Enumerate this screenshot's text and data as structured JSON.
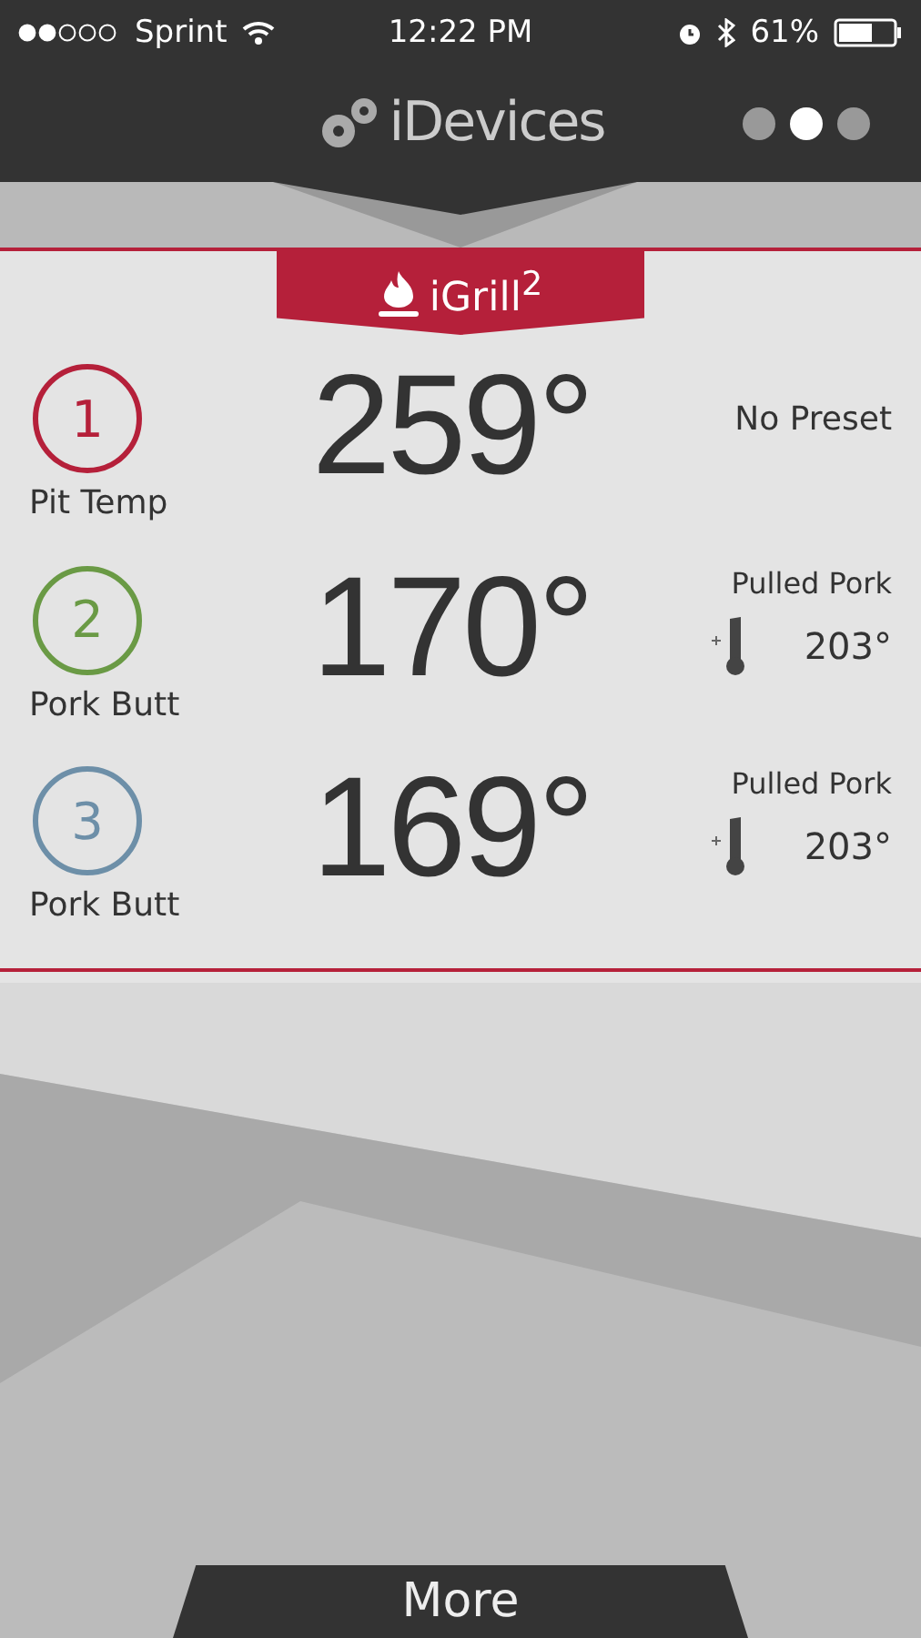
{
  "status_bar": {
    "carrier": "Sprint",
    "time": "12:22 PM",
    "battery": "61%"
  },
  "header": {
    "logo": "iDevices",
    "pages": [
      {
        "selected": false
      },
      {
        "selected": true
      },
      {
        "selected": false
      }
    ]
  },
  "device": {
    "name": "iGrill$^{2}$"
  },
  "probes": [
    {
      "number": "1",
      "label": "Pit Temp",
      "temp": "259°",
      "color": "#b5203a",
      "kind": "none",
      "preset": "No Preset"
    },
    {
      "number": "2",
      "label": "Pork Butt",
      "temp": "170°",
      "color": "#6a9a45",
      "kind": "target",
      "preset": "Pulled Pork",
      "target": "203°"
    },
    {
      "number": "3",
      "label": "Pork Butt",
      "temp": "169°",
      "color": "#6d8fa8",
      "kind": "target",
      "preset": "Pulled Pork",
      "target": "203°"
    }
  ],
  "more_button": "More"
}
